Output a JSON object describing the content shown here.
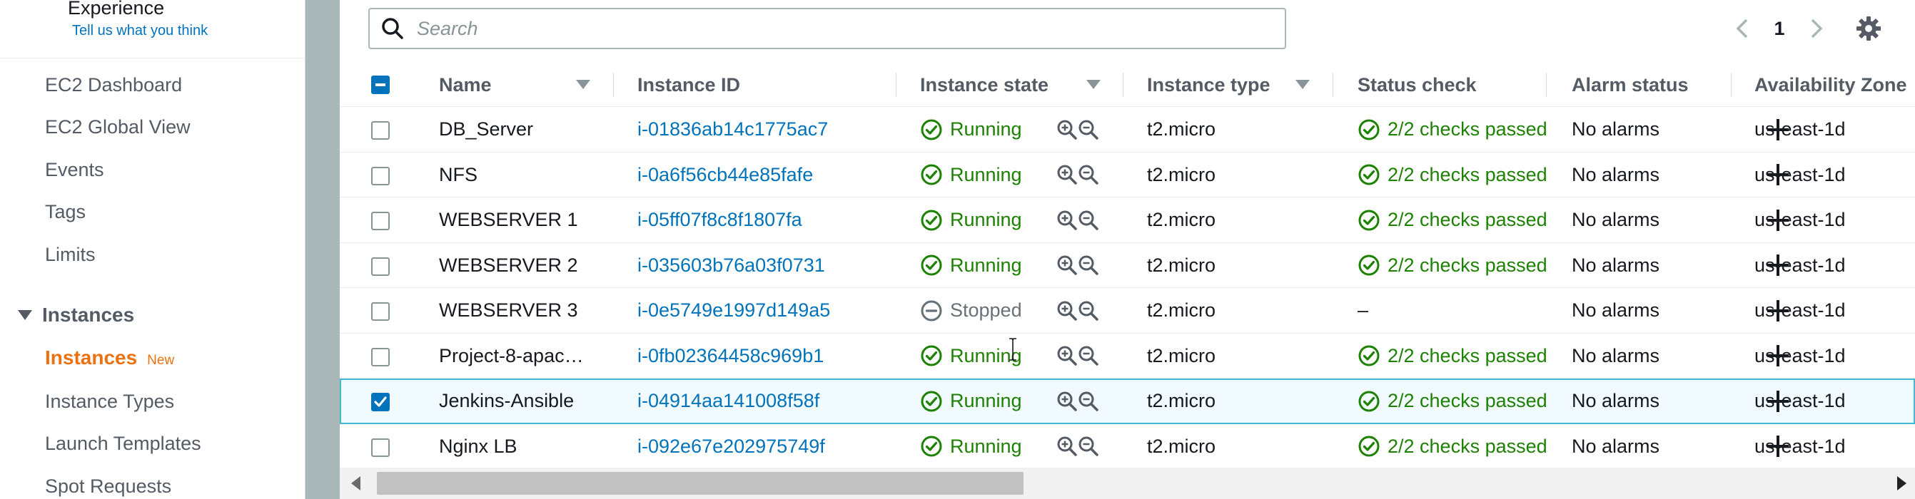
{
  "sidebar": {
    "experience_title": "Experience",
    "feedback_link": "Tell us what you think",
    "items": [
      {
        "label": "EC2 Dashboard"
      },
      {
        "label": "EC2 Global View"
      },
      {
        "label": "Events"
      },
      {
        "label": "Tags"
      },
      {
        "label": "Limits"
      }
    ],
    "section": {
      "label": "Instances"
    },
    "active_item": {
      "label": "Instances",
      "badge": "New"
    },
    "sub_items": [
      {
        "label": "Instance Types"
      },
      {
        "label": "Launch Templates"
      },
      {
        "label": "Spot Requests"
      }
    ]
  },
  "search": {
    "placeholder": "Search"
  },
  "pagination": {
    "current_page": "1"
  },
  "table": {
    "columns": {
      "name": "Name",
      "instance_id": "Instance ID",
      "instance_state": "Instance state",
      "instance_type": "Instance type",
      "status_check": "Status check",
      "alarm_status": "Alarm status",
      "availability_zone": "Availability Zone"
    },
    "rows": [
      {
        "name": "DB_Server",
        "id": "i-01836ab14c1775ac7",
        "state": "Running",
        "type": "t2.micro",
        "check": "2/2 checks passed",
        "alarm": "No alarms",
        "az": "us-east-1d",
        "selected": false
      },
      {
        "name": "NFS",
        "id": "i-0a6f56cb44e85fafe",
        "state": "Running",
        "type": "t2.micro",
        "check": "2/2 checks passed",
        "alarm": "No alarms",
        "az": "us-east-1d",
        "selected": false
      },
      {
        "name": "WEBSERVER 1",
        "id": "i-05ff07f8c8f1807fa",
        "state": "Running",
        "type": "t2.micro",
        "check": "2/2 checks passed",
        "alarm": "No alarms",
        "az": "us-east-1d",
        "selected": false
      },
      {
        "name": "WEBSERVER 2",
        "id": "i-035603b76a03f0731",
        "state": "Running",
        "type": "t2.micro",
        "check": "2/2 checks passed",
        "alarm": "No alarms",
        "az": "us-east-1d",
        "selected": false
      },
      {
        "name": "WEBSERVER 3",
        "id": "i-0e5749e1997d149a5",
        "state": "Stopped",
        "type": "t2.micro",
        "check": "–",
        "alarm": "No alarms",
        "az": "us-east-1d",
        "selected": false
      },
      {
        "name": "Project-8-apac…",
        "id": "i-0fb02364458c969b1",
        "state": "Running",
        "type": "t2.micro",
        "check": "2/2 checks passed",
        "alarm": "No alarms",
        "az": "us-east-1d",
        "selected": false
      },
      {
        "name": "Jenkins-Ansible",
        "id": "i-04914aa141008f58f",
        "state": "Running",
        "type": "t2.micro",
        "check": "2/2 checks passed",
        "alarm": "No alarms",
        "az": "us-east-1d",
        "selected": true
      },
      {
        "name": "Nginx LB",
        "id": "i-092e67e202975749f",
        "state": "Running",
        "type": "t2.micro",
        "check": "2/2 checks passed",
        "alarm": "No alarms",
        "az": "us-east-1d",
        "selected": false
      }
    ]
  },
  "colors": {
    "link": "#0073bb",
    "running": "#1d8102",
    "stopped": "#687078",
    "active_nav": "#ec7211",
    "selected_row_bg": "#f1faff",
    "selected_row_border": "#44b9d6"
  },
  "icons": {
    "search": "search-icon",
    "prev": "chevron-left-icon",
    "next": "chevron-right-icon",
    "settings": "gear-icon",
    "running": "check-circle-icon",
    "stopped": "minus-circle-icon",
    "zoom_in": "zoom-in-icon",
    "zoom_out": "zoom-out-icon",
    "add_alarm": "plus-icon"
  }
}
